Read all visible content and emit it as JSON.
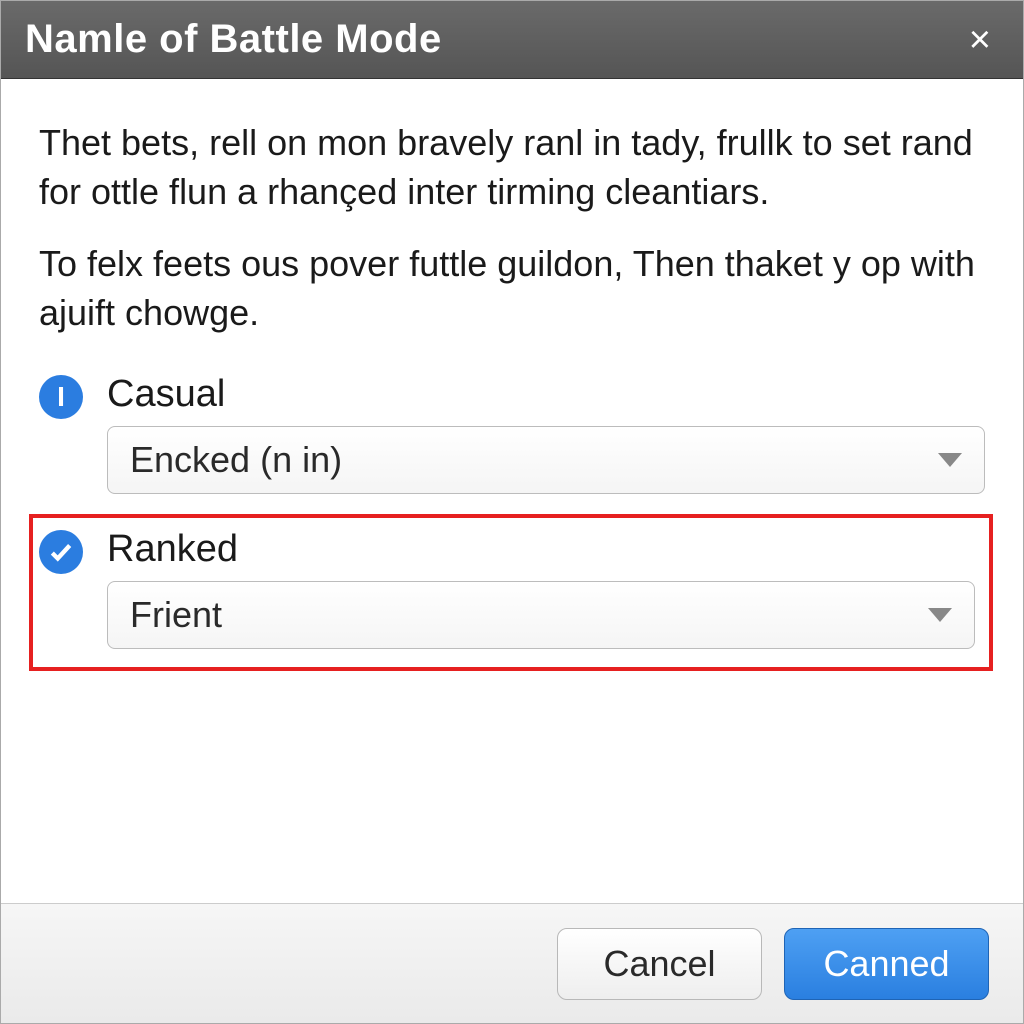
{
  "dialog": {
    "title": "Namle of Battle Mode",
    "close_label": "×"
  },
  "description": {
    "paragraph1": "Thet bets, rell on mon bravely ranl in tady, frullk to set rand for ottle flun a rhançed inter tirming cleantiars.",
    "paragraph2": "To felx feets ous pover futtle guildon, Then thaket y op with ajuift chowge."
  },
  "options": {
    "casual": {
      "label": "Casual",
      "value": "Encked (n in)",
      "icon_glyph": "I"
    },
    "ranked": {
      "label": "Ranked",
      "value": "Frient"
    }
  },
  "buttons": {
    "cancel": "Cancel",
    "confirm": "Canned"
  },
  "colors": {
    "accent_blue": "#2b7de0",
    "highlight_red": "#e62020",
    "titlebar_bg": "#5d5d5d"
  }
}
